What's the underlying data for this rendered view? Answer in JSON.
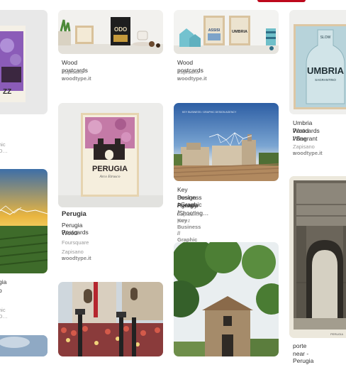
{
  "pins": [
    {
      "id": "wood1",
      "title": "Wood postcards",
      "saved_from_prefix": "Zapisano z",
      "saved_from_source": "woodtype.it"
    },
    {
      "id": "wood2",
      "title": "Wood postcards",
      "saved_from_prefix": "Zapisano z",
      "saved_from_source": "woodtype.it"
    },
    {
      "id": "umbria",
      "title_lines": [
        "Umbria Wood",
        "Postcards / Sagrant",
        "Wine"
      ],
      "saved_from_prefix": "Zapisano z",
      "saved_from_source": "woodtype.it"
    },
    {
      "id": "perugia",
      "title": "Perugia",
      "desc_lines": [
        "Perugia Wood",
        "Postcards"
      ],
      "source_label": "Foursquare",
      "saved_from_prefix": "Zapisano z",
      "saved_from_source": "woodtype.it"
    },
    {
      "id": "keybiz",
      "title_lines": [
        "Key Business / Graphic",
        "Design Agency /",
        "Perugia /Shooting…"
      ],
      "saved_from_prefix": "Zapisane przez",
      "saved_from_source": "Key Business // Graphic D…"
    },
    {
      "id": "left1",
      "title_fragment": "l",
      "saved_fragment": "hic D…"
    },
    {
      "id": "left2",
      "title_fragment": "gia",
      "title2_fragment": "o",
      "saved_fragment": "hic D…"
    },
    {
      "id": "archway",
      "title_fragment": "porte near - Perugia"
    }
  ],
  "image_text": {
    "perugia_poster_title": "PERUGIA",
    "perugia_poster_sub": "Arco Etrusco",
    "umbria_bottle_title": "UMBRIA",
    "umbria_bottle_top": "SLOW",
    "umbria_bottle_sub": "SAGRANTINO",
    "keybiz_overlay": "KEY BUSINESS / GRAPHIC DESIGN AGENCY",
    "wood1_card": "ODO",
    "wood2_card1": "ASSISI",
    "wood2_card2": "UMBRIA",
    "archway_caption": "PERUGIA"
  },
  "colors": {
    "accent": "#bd081c",
    "title": "#333333",
    "meta": "#999999"
  }
}
